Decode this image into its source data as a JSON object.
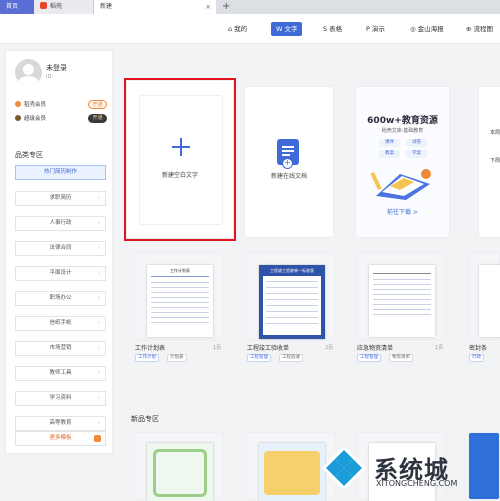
{
  "tabs": [
    {
      "label": "首页"
    },
    {
      "label": "稻壳"
    },
    {
      "label": "新建",
      "close": "×"
    }
  ],
  "tab_add": "+",
  "topnav": [
    {
      "icon": "home-icon",
      "glyph": "⌂",
      "label": "我的"
    },
    {
      "icon": "w-icon",
      "glyph": "W",
      "label": "文字",
      "active": true
    },
    {
      "icon": "s-icon",
      "glyph": "S",
      "label": "表格"
    },
    {
      "icon": "p-icon",
      "glyph": "P",
      "label": "演示"
    },
    {
      "icon": "poster-icon",
      "glyph": "◎",
      "label": "金山海报"
    },
    {
      "icon": "flow-icon",
      "glyph": "⊕",
      "label": "流程图"
    }
  ],
  "user": {
    "name": "未登录",
    "id_label": "ID:"
  },
  "vip": [
    {
      "label": "稻壳会员",
      "button": "开通",
      "color": "#f08a3a"
    },
    {
      "label": "超级会员",
      "button": "开通",
      "color": "#7a5a2a"
    }
  ],
  "sidebar": {
    "section_title": "品类专区",
    "categories": [
      {
        "label": "热门简历制作",
        "active": true
      },
      {
        "label": "求职简历"
      },
      {
        "label": "人事行政"
      },
      {
        "label": "法律合同"
      },
      {
        "label": "平面设计"
      },
      {
        "label": "职场办公"
      },
      {
        "label": "信纸手帐"
      },
      {
        "label": "市场营销"
      },
      {
        "label": "教师工具"
      },
      {
        "label": "学习资料"
      },
      {
        "label": "高等教育"
      },
      {
        "label": "更多模板",
        "more": true
      }
    ]
  },
  "create_cards": [
    {
      "label": "新建空白文字"
    },
    {
      "label": "新建在线文档"
    }
  ],
  "edu_banner": {
    "title": "600w+教育资源",
    "subtitle": "稻壳文库·基础教育",
    "tags": [
      "课件",
      "试卷",
      "教案",
      "学案"
    ],
    "link": "前往下载 >"
  },
  "templates": [
    {
      "title": "工作计划表",
      "pages": "1页",
      "tags": [
        "工作计划",
        "计划表"
      ],
      "thumb_title": "工作计划表"
    },
    {
      "title": "工程竣工验收单",
      "pages": "2页",
      "tags": [
        "工程管理",
        "工程验收"
      ],
      "thumb_title": "工程竣工验收单一标准版"
    },
    {
      "title": "应急物资清单",
      "pages": "1页",
      "tags": [
        "工程管理",
        "物资清单"
      ]
    },
    {
      "title": "密封条",
      "pages": "",
      "tags": [
        "行政"
      ]
    }
  ],
  "new_section": "新品专区",
  "partial_right": {
    "line1": "本周",
    "line2": "下周"
  },
  "watermark": {
    "text": "系统城",
    "url": "XITONGCHENG.COM"
  },
  "colors": {
    "accent": "#3f6ad8",
    "highlight": "#e0141e",
    "orange": "#f08a3a"
  }
}
